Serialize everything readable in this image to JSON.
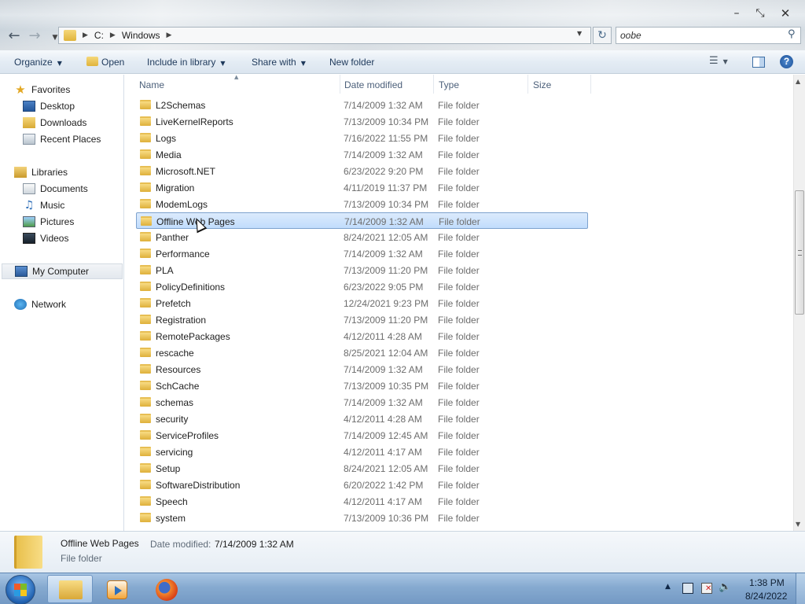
{
  "window": {
    "minimize_glyph": "–",
    "maximize_glyph": "⤡",
    "close_glyph": "✕"
  },
  "address_bar": {
    "crumbs": [
      "C:",
      "Windows"
    ],
    "separator": "▶",
    "dropdown_glyph": "▼"
  },
  "search": {
    "value": "oobe"
  },
  "toolbar": {
    "organize": "Organize",
    "open": "Open",
    "include_in_library": "Include in library",
    "share_with": "Share with",
    "new_folder": "New folder",
    "dropdown_glyph": "▼",
    "help": "?"
  },
  "nav_pane": {
    "favorites": {
      "label": "Favorites",
      "items": [
        "Desktop",
        "Downloads",
        "Recent Places"
      ]
    },
    "libraries": {
      "label": "Libraries",
      "items": [
        "Documents",
        "Music",
        "Pictures",
        "Videos"
      ]
    },
    "computer": "My Computer",
    "network": "Network"
  },
  "columns": {
    "name": "Name",
    "date_modified": "Date modified",
    "type": "Type",
    "size": "Size"
  },
  "files": [
    {
      "name": "L2Schemas",
      "date": "7/14/2009 1:32 AM",
      "type": "File folder"
    },
    {
      "name": "LiveKernelReports",
      "date": "7/13/2009 10:34 PM",
      "type": "File folder"
    },
    {
      "name": "Logs",
      "date": "7/16/2022 11:55 PM",
      "type": "File folder"
    },
    {
      "name": "Media",
      "date": "7/14/2009 1:32 AM",
      "type": "File folder"
    },
    {
      "name": "Microsoft.NET",
      "date": "6/23/2022 9:20 PM",
      "type": "File folder"
    },
    {
      "name": "Migration",
      "date": "4/11/2019 11:37 PM",
      "type": "File folder"
    },
    {
      "name": "ModemLogs",
      "date": "7/13/2009 10:34 PM",
      "type": "File folder"
    },
    {
      "name": "Offline Web Pages",
      "date": "7/14/2009 1:32 AM",
      "type": "File folder",
      "selected": true
    },
    {
      "name": "Panther",
      "date": "8/24/2021 12:05 AM",
      "type": "File folder"
    },
    {
      "name": "Performance",
      "date": "7/14/2009 1:32 AM",
      "type": "File folder"
    },
    {
      "name": "PLA",
      "date": "7/13/2009 11:20 PM",
      "type": "File folder"
    },
    {
      "name": "PolicyDefinitions",
      "date": "6/23/2022 9:05 PM",
      "type": "File folder"
    },
    {
      "name": "Prefetch",
      "date": "12/24/2021 9:23 PM",
      "type": "File folder"
    },
    {
      "name": "Registration",
      "date": "7/13/2009 11:20 PM",
      "type": "File folder"
    },
    {
      "name": "RemotePackages",
      "date": "4/12/2011 4:28 AM",
      "type": "File folder"
    },
    {
      "name": "rescache",
      "date": "8/25/2021 12:04 AM",
      "type": "File folder"
    },
    {
      "name": "Resources",
      "date": "7/14/2009 1:32 AM",
      "type": "File folder"
    },
    {
      "name": "SchCache",
      "date": "7/13/2009 10:35 PM",
      "type": "File folder"
    },
    {
      "name": "schemas",
      "date": "7/14/2009 1:32 AM",
      "type": "File folder"
    },
    {
      "name": "security",
      "date": "4/12/2011 4:28 AM",
      "type": "File folder"
    },
    {
      "name": "ServiceProfiles",
      "date": "7/14/2009 12:45 AM",
      "type": "File folder"
    },
    {
      "name": "servicing",
      "date": "4/12/2011 4:17 AM",
      "type": "File folder"
    },
    {
      "name": "Setup",
      "date": "8/24/2021 12:05 AM",
      "type": "File folder"
    },
    {
      "name": "SoftwareDistribution",
      "date": "6/20/2022 1:42 PM",
      "type": "File folder"
    },
    {
      "name": "Speech",
      "date": "4/12/2011 4:17 AM",
      "type": "File folder"
    },
    {
      "name": "system",
      "date": "7/13/2009 10:36 PM",
      "type": "File folder"
    }
  ],
  "details": {
    "name": "Offline Web Pages",
    "date_label": "Date modified:",
    "date": "7/14/2009 1:32 AM",
    "type": "File folder"
  },
  "taskbar": {
    "apps": [
      "Windows Explorer",
      "Windows Media Player",
      "Firefox"
    ],
    "time": "1:38 PM",
    "date": "8/24/2022"
  },
  "icons": {
    "back": "back-arrow-icon",
    "forward": "forward-arrow-icon",
    "refresh": "refresh-icon",
    "search": "magnifier-icon",
    "folder": "folder-icon"
  },
  "colors": {
    "selection_bg": "#cce4fc",
    "selection_border": "#7da2ce",
    "toolbar_text": "#1e395b",
    "taskbar": "#86aad0"
  }
}
